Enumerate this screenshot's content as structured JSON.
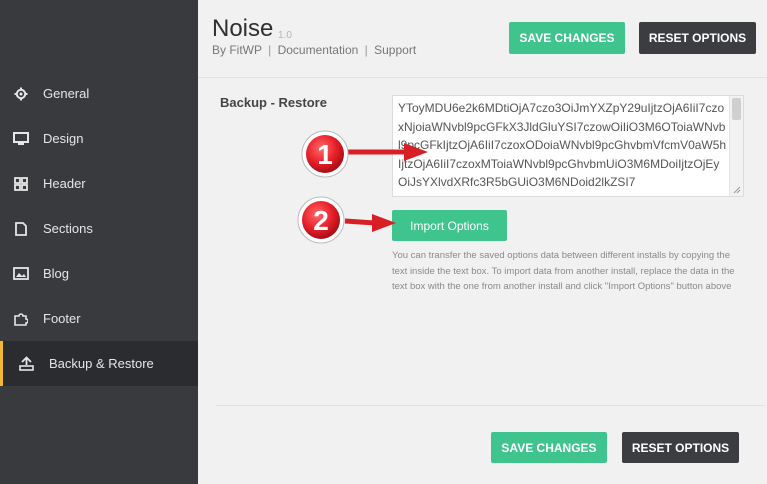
{
  "sidebar": {
    "items": [
      {
        "label": "General",
        "icon": "gear-icon"
      },
      {
        "label": "Design",
        "icon": "monitor-icon"
      },
      {
        "label": "Header",
        "icon": "grid-icon"
      },
      {
        "label": "Sections",
        "icon": "document-icon"
      },
      {
        "label": "Blog",
        "icon": "image-icon"
      },
      {
        "label": "Footer",
        "icon": "puzzle-icon"
      },
      {
        "label": "Backup & Restore",
        "icon": "backup-icon"
      }
    ],
    "active_index": 6,
    "accent": "#f3b833"
  },
  "header": {
    "title": "Noise",
    "version": "1.0",
    "by": "By FitWP",
    "documentation": "Documentation",
    "support": "Support",
    "separator": "|"
  },
  "buttons": {
    "save": "SAVE CHANGES",
    "reset": "RESET OPTIONS",
    "import": "Import Options",
    "save_color": "#3fc48e",
    "reset_color": "#3c3d41"
  },
  "backup": {
    "label": "Backup - Restore",
    "textarea_value": "YToyMDU6e2k6MDtiOjA7czo3OiJmYXZpY29uIjtzOjA6IiI7czoxNjoiaWNvbl9pcGFkX3JldGluYSI7czowOiIiO3M6OToiaWNvbl9pcGFkIjtzOjA6IiI7czoxODoiaWNvbl9pcGhvbmVfcmV0aW5hIjtzOjA6IiI7czoxMToiaWNvbl9pcGhvbmUiO3M6MDoiIjtzOjEyOiJsYXlvdXRfc3R5bGUiO3M6NDoid2lkZSI7",
    "help": "You can transfer the saved options data between different installs by copying the text inside the text box. To import data from another install, replace the data in the text box with the one from another install and click \"Import Options\" button above"
  },
  "annotations": {
    "marker_1": "1",
    "marker_2": "2",
    "marker_color": "#e8202a",
    "arrow_color": "#d81e27"
  }
}
